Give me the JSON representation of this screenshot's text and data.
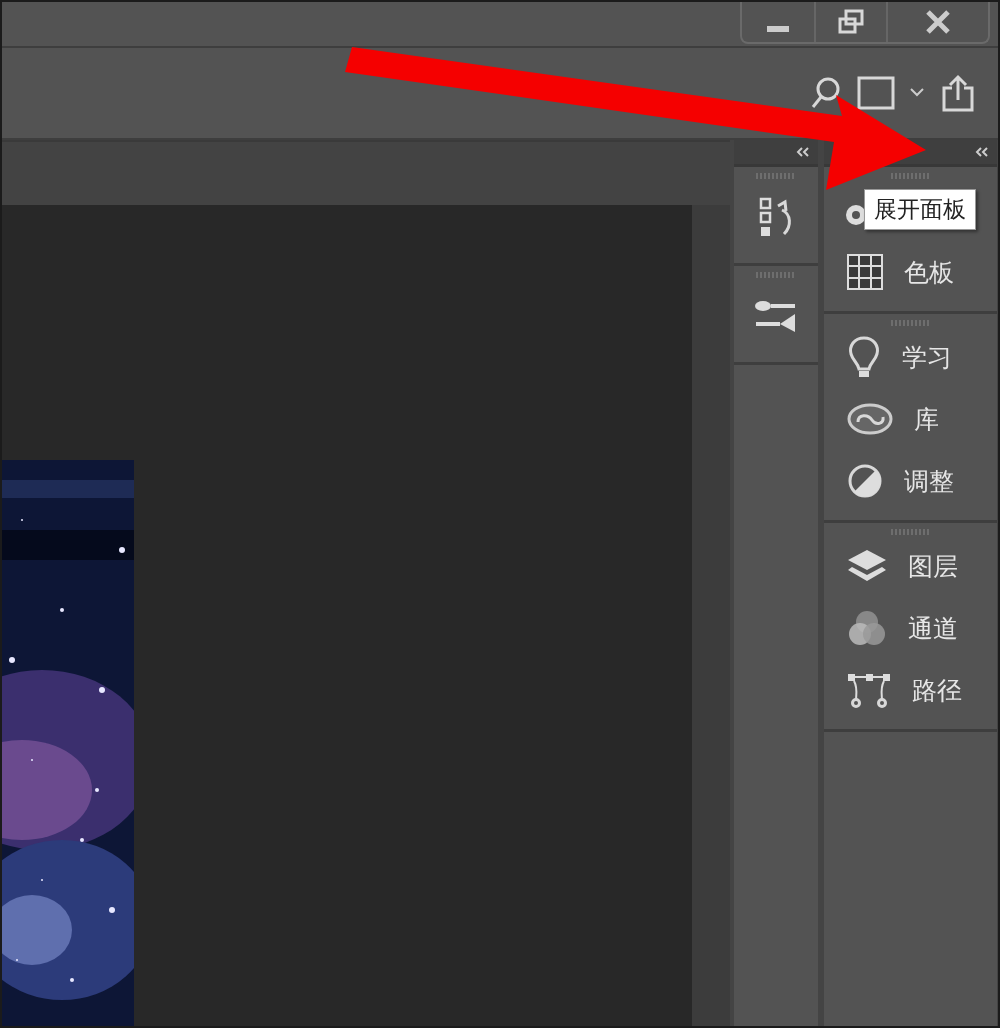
{
  "window": {
    "controls": [
      {
        "kind": "minimize"
      },
      {
        "kind": "restore"
      },
      {
        "kind": "close"
      }
    ]
  },
  "toolbar": {
    "buttons": [
      {
        "kind": "search"
      },
      {
        "kind": "screen-mode"
      },
      {
        "kind": "share"
      }
    ]
  },
  "panel_dock": {
    "columns": [
      {
        "groups": [
          {
            "items": [
              {
                "kind": "history"
              }
            ]
          },
          {
            "items": [
              {
                "kind": "brush-settings"
              }
            ]
          }
        ]
      },
      {
        "groups": [
          {
            "items": [
              {
                "kind": "color"
              },
              {
                "kind": "swatches",
                "label": "色板"
              }
            ]
          },
          {
            "items": [
              {
                "kind": "learn",
                "label": "学习"
              },
              {
                "kind": "libraries",
                "label": "库"
              },
              {
                "kind": "adjustments",
                "label": "调整"
              }
            ]
          },
          {
            "items": [
              {
                "kind": "layers",
                "label": "图层"
              },
              {
                "kind": "channels",
                "label": "通道"
              },
              {
                "kind": "paths",
                "label": "路径"
              }
            ]
          }
        ]
      }
    ]
  },
  "tooltip": {
    "text": "展开面板"
  },
  "annotations": [
    {
      "kind": "arrow"
    }
  ]
}
